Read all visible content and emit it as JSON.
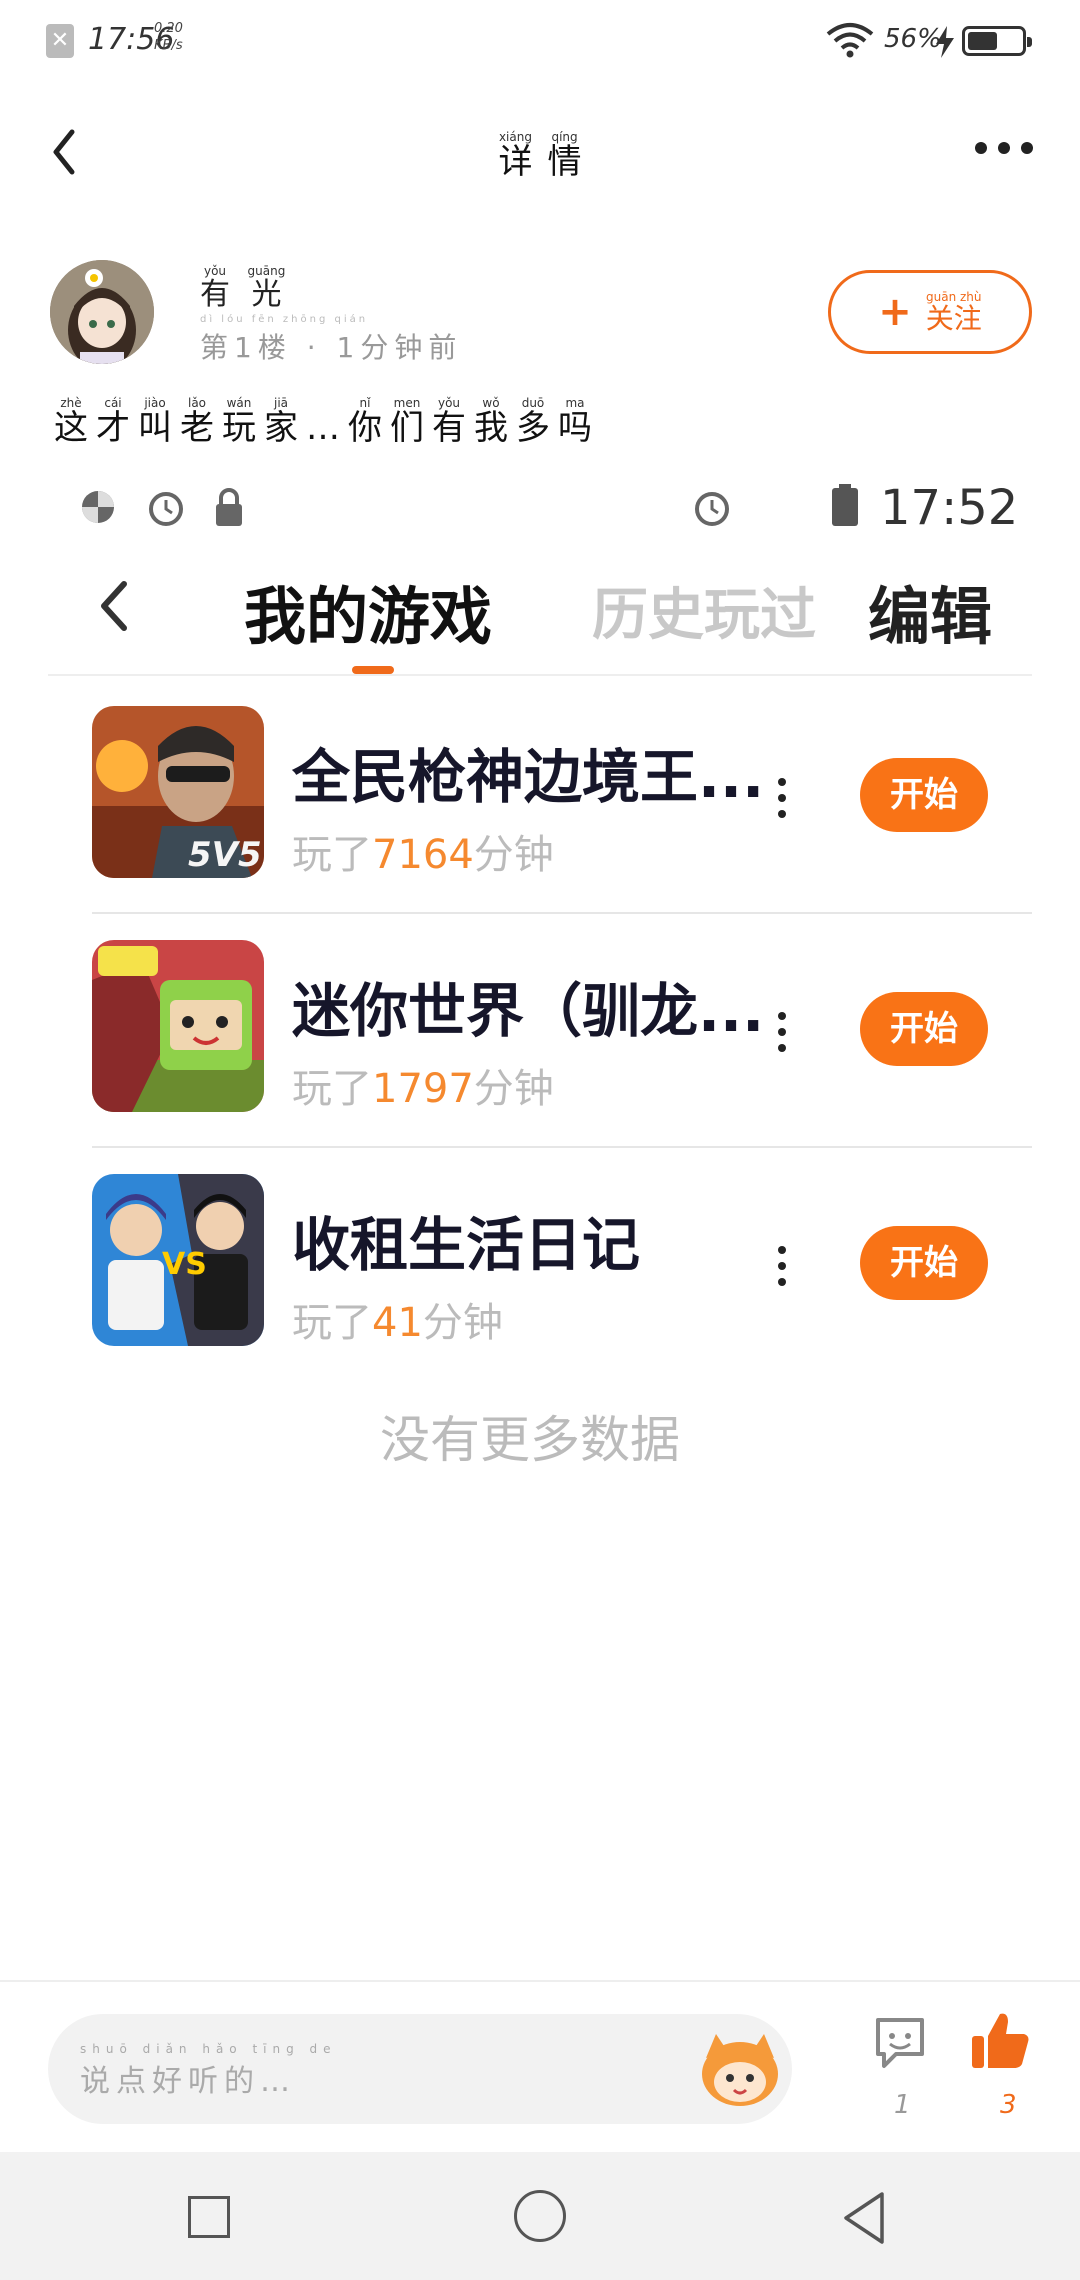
{
  "status_bar": {
    "time": "17:56",
    "speed_value": "0.20",
    "speed_unit": "KB/s",
    "battery_pct": "56%",
    "battery_level": 0.56
  },
  "nav": {
    "title_pinyin": [
      "xiáng",
      "qíng"
    ],
    "title_chars": [
      "详",
      "情"
    ]
  },
  "post": {
    "author_pinyin": [
      "yǒu",
      "guāng"
    ],
    "author_chars": [
      "有",
      "光"
    ],
    "meta": "第1楼 · 1分钟前",
    "meta_pinyin": "dì  lóu   fēn zhōng qián",
    "follow_label": "关注",
    "follow_pinyin": "guān zhù",
    "text_pinyin": [
      "zhè",
      "cái",
      "jiào",
      "lǎo",
      "wán",
      "jiā",
      "",
      "nǐ",
      "men",
      "yǒu",
      "wǒ",
      "duō",
      "ma"
    ],
    "text_chars": [
      "这",
      "才",
      "叫",
      "老",
      "玩",
      "家",
      "…",
      "你",
      "们",
      "有",
      "我",
      "多",
      "吗"
    ]
  },
  "embedded": {
    "time": "17:52",
    "tab_active": "我的游戏",
    "tab_history": "历史玩过",
    "edit_label": "编辑",
    "games": [
      {
        "title": "全民枪神边境王...",
        "played_prefix": "玩了",
        "minutes": "7164",
        "played_suffix": "分钟",
        "start_label": "开始"
      },
      {
        "title": "迷你世界（驯龙...",
        "played_prefix": "玩了",
        "minutes": "1797",
        "played_suffix": "分钟",
        "start_label": "开始"
      },
      {
        "title": "收租生活日记",
        "played_prefix": "玩了",
        "minutes": "41",
        "played_suffix": "分钟",
        "start_label": "开始"
      }
    ],
    "no_more": "没有更多数据"
  },
  "comment_bar": {
    "placeholder": "说点好听的…",
    "placeholder_pinyin": "shuō diǎn hǎo tīng de",
    "msg_count": "1",
    "like_count": "3"
  },
  "icons": {
    "back": "chevron-left-icon",
    "more": "more-dots-icon",
    "comment": "message-icon",
    "like": "thumbs-up-icon",
    "accent": "#f97316"
  }
}
